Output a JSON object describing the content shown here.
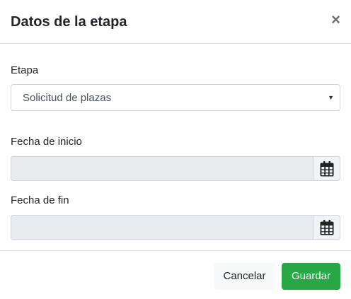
{
  "modal": {
    "title": "Datos de la etapa",
    "close_symbol": "×"
  },
  "form": {
    "stage_label": "Etapa",
    "stage_value": "Solicitud de plazas",
    "start_date_label": "Fecha de inicio",
    "start_date_value": "",
    "end_date_label": "Fecha de fin",
    "end_date_value": ""
  },
  "icons": {
    "select_caret": "chevron-down-icon",
    "date_picker": "calendar-icon"
  },
  "footer": {
    "cancel_label": "Cancelar",
    "save_label": "Guardar"
  },
  "colors": {
    "save_button": "#28a745",
    "readonly_input": "#e9ecef"
  }
}
